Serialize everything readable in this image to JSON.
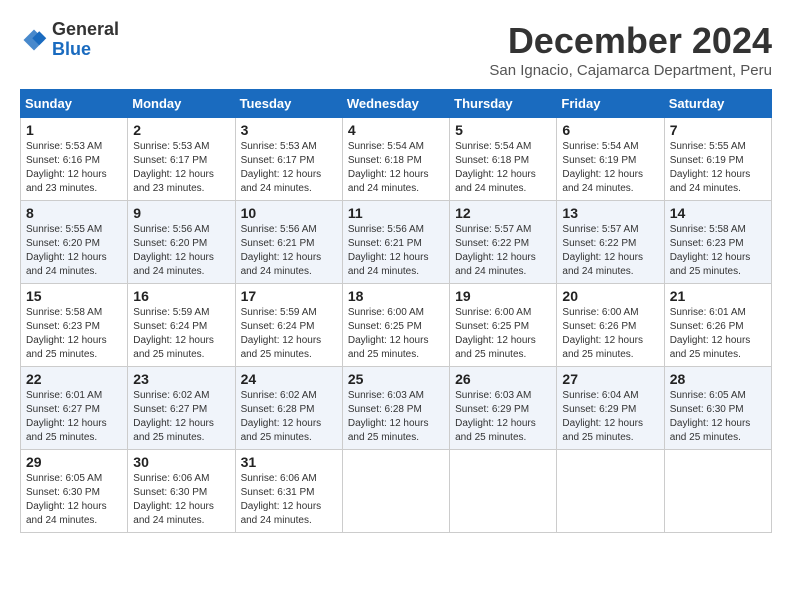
{
  "logo": {
    "general": "General",
    "blue": "Blue"
  },
  "header": {
    "month": "December 2024",
    "location": "San Ignacio, Cajamarca Department, Peru"
  },
  "weekdays": [
    "Sunday",
    "Monday",
    "Tuesday",
    "Wednesday",
    "Thursday",
    "Friday",
    "Saturday"
  ],
  "weeks": [
    [
      {
        "day": "1",
        "sunrise": "5:53 AM",
        "sunset": "6:16 PM",
        "daylight": "12 hours and 23 minutes."
      },
      {
        "day": "2",
        "sunrise": "5:53 AM",
        "sunset": "6:17 PM",
        "daylight": "12 hours and 23 minutes."
      },
      {
        "day": "3",
        "sunrise": "5:53 AM",
        "sunset": "6:17 PM",
        "daylight": "12 hours and 24 minutes."
      },
      {
        "day": "4",
        "sunrise": "5:54 AM",
        "sunset": "6:18 PM",
        "daylight": "12 hours and 24 minutes."
      },
      {
        "day": "5",
        "sunrise": "5:54 AM",
        "sunset": "6:18 PM",
        "daylight": "12 hours and 24 minutes."
      },
      {
        "day": "6",
        "sunrise": "5:54 AM",
        "sunset": "6:19 PM",
        "daylight": "12 hours and 24 minutes."
      },
      {
        "day": "7",
        "sunrise": "5:55 AM",
        "sunset": "6:19 PM",
        "daylight": "12 hours and 24 minutes."
      }
    ],
    [
      {
        "day": "8",
        "sunrise": "5:55 AM",
        "sunset": "6:20 PM",
        "daylight": "12 hours and 24 minutes."
      },
      {
        "day": "9",
        "sunrise": "5:56 AM",
        "sunset": "6:20 PM",
        "daylight": "12 hours and 24 minutes."
      },
      {
        "day": "10",
        "sunrise": "5:56 AM",
        "sunset": "6:21 PM",
        "daylight": "12 hours and 24 minutes."
      },
      {
        "day": "11",
        "sunrise": "5:56 AM",
        "sunset": "6:21 PM",
        "daylight": "12 hours and 24 minutes."
      },
      {
        "day": "12",
        "sunrise": "5:57 AM",
        "sunset": "6:22 PM",
        "daylight": "12 hours and 24 minutes."
      },
      {
        "day": "13",
        "sunrise": "5:57 AM",
        "sunset": "6:22 PM",
        "daylight": "12 hours and 24 minutes."
      },
      {
        "day": "14",
        "sunrise": "5:58 AM",
        "sunset": "6:23 PM",
        "daylight": "12 hours and 25 minutes."
      }
    ],
    [
      {
        "day": "15",
        "sunrise": "5:58 AM",
        "sunset": "6:23 PM",
        "daylight": "12 hours and 25 minutes."
      },
      {
        "day": "16",
        "sunrise": "5:59 AM",
        "sunset": "6:24 PM",
        "daylight": "12 hours and 25 minutes."
      },
      {
        "day": "17",
        "sunrise": "5:59 AM",
        "sunset": "6:24 PM",
        "daylight": "12 hours and 25 minutes."
      },
      {
        "day": "18",
        "sunrise": "6:00 AM",
        "sunset": "6:25 PM",
        "daylight": "12 hours and 25 minutes."
      },
      {
        "day": "19",
        "sunrise": "6:00 AM",
        "sunset": "6:25 PM",
        "daylight": "12 hours and 25 minutes."
      },
      {
        "day": "20",
        "sunrise": "6:00 AM",
        "sunset": "6:26 PM",
        "daylight": "12 hours and 25 minutes."
      },
      {
        "day": "21",
        "sunrise": "6:01 AM",
        "sunset": "6:26 PM",
        "daylight": "12 hours and 25 minutes."
      }
    ],
    [
      {
        "day": "22",
        "sunrise": "6:01 AM",
        "sunset": "6:27 PM",
        "daylight": "12 hours and 25 minutes."
      },
      {
        "day": "23",
        "sunrise": "6:02 AM",
        "sunset": "6:27 PM",
        "daylight": "12 hours and 25 minutes."
      },
      {
        "day": "24",
        "sunrise": "6:02 AM",
        "sunset": "6:28 PM",
        "daylight": "12 hours and 25 minutes."
      },
      {
        "day": "25",
        "sunrise": "6:03 AM",
        "sunset": "6:28 PM",
        "daylight": "12 hours and 25 minutes."
      },
      {
        "day": "26",
        "sunrise": "6:03 AM",
        "sunset": "6:29 PM",
        "daylight": "12 hours and 25 minutes."
      },
      {
        "day": "27",
        "sunrise": "6:04 AM",
        "sunset": "6:29 PM",
        "daylight": "12 hours and 25 minutes."
      },
      {
        "day": "28",
        "sunrise": "6:05 AM",
        "sunset": "6:30 PM",
        "daylight": "12 hours and 25 minutes."
      }
    ],
    [
      {
        "day": "29",
        "sunrise": "6:05 AM",
        "sunset": "6:30 PM",
        "daylight": "12 hours and 24 minutes."
      },
      {
        "day": "30",
        "sunrise": "6:06 AM",
        "sunset": "6:30 PM",
        "daylight": "12 hours and 24 minutes."
      },
      {
        "day": "31",
        "sunrise": "6:06 AM",
        "sunset": "6:31 PM",
        "daylight": "12 hours and 24 minutes."
      },
      null,
      null,
      null,
      null
    ]
  ],
  "labels": {
    "sunrise": "Sunrise:",
    "sunset": "Sunset:",
    "daylight": "Daylight:"
  }
}
